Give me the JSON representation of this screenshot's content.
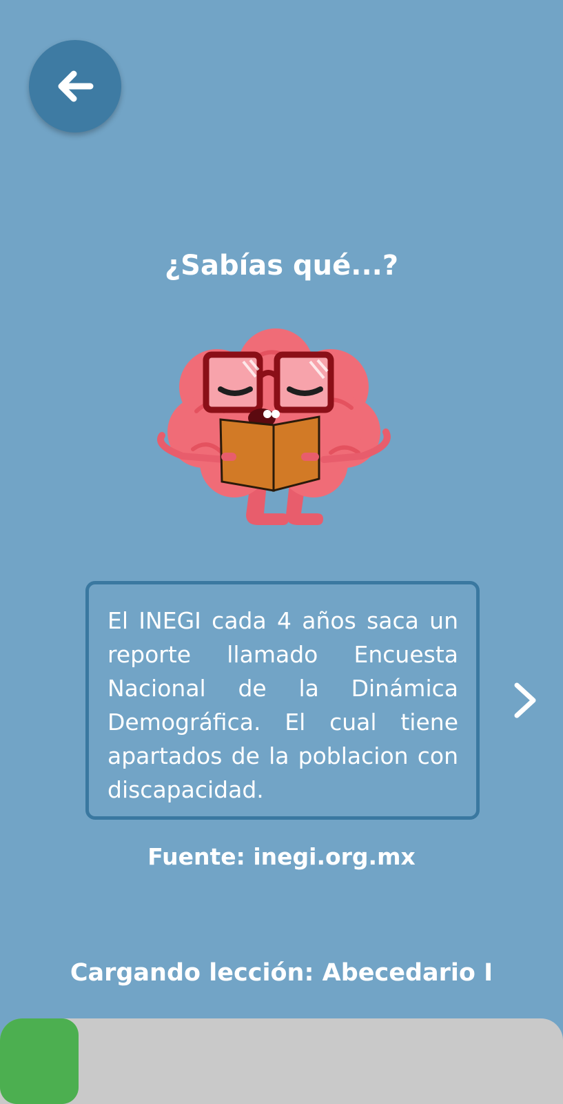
{
  "header": {
    "back_icon": "arrow-left-icon"
  },
  "fact": {
    "title": "¿Sabías qué...?",
    "text": "El INEGI cada 4 años saca un reporte llamado Encuesta Nacional de la Dinámica Demográfica. El cual tiene apartados de la poblacion con discapacidad.",
    "source": "Fuente: inegi.org.mx",
    "next_icon": "chevron-right-icon"
  },
  "mascot": {
    "icon": "brain-reading-book-icon"
  },
  "loading": {
    "label": "Cargando lección: Abecedario I",
    "progress_percent": 14
  },
  "colors": {
    "background": "#72a4c6",
    "back_button": "#3e7ba3",
    "card_border": "#3a78a0",
    "progress_fill": "#4caf50",
    "progress_track": "#c9c9c9"
  }
}
